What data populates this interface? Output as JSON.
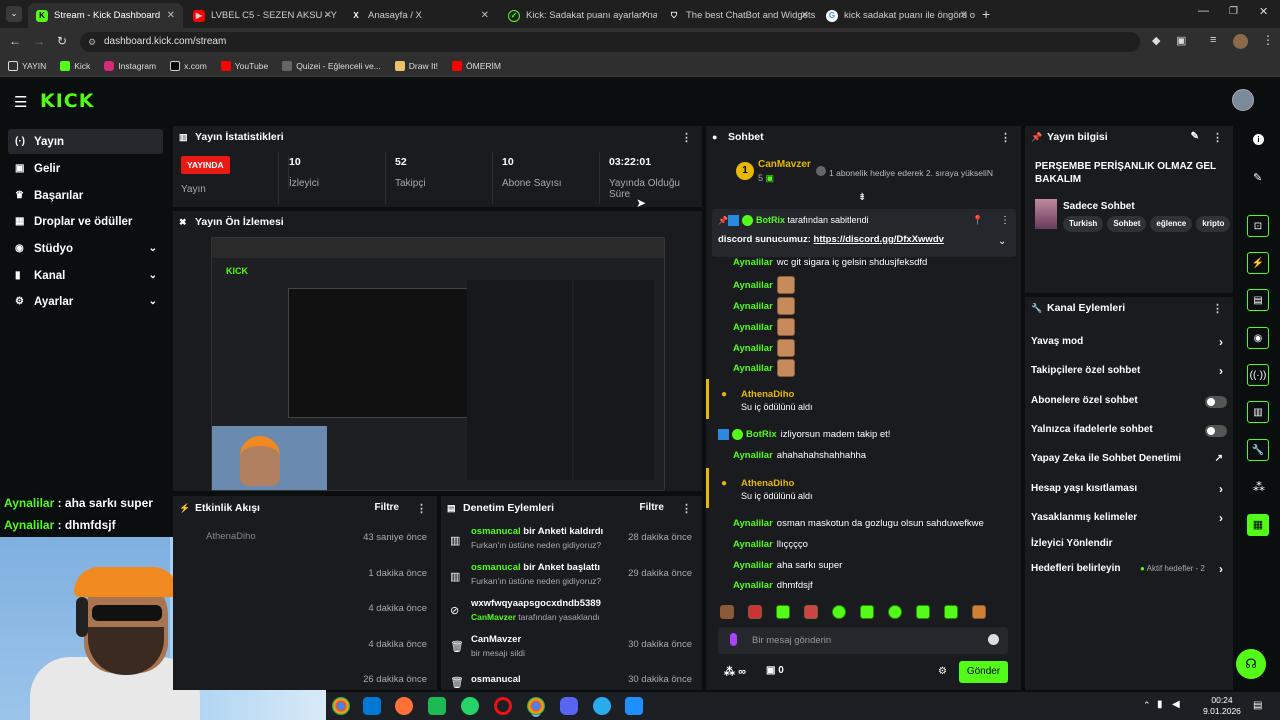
{
  "browser": {
    "tabs": [
      {
        "title": "Stream - Kick Dashboard",
        "color": "#53fc18",
        "active": true
      },
      {
        "title": "LVBEL C5 - SEZEN AKSU - Y",
        "color": "#ff0000"
      },
      {
        "title": "Anasayfa / X",
        "color": "#000000"
      },
      {
        "title": "Kick: Sadakat puanı ayarları nas",
        "color": "#53fc18"
      },
      {
        "title": "The best ChatBot and Widgets",
        "color": "#6a5acd"
      },
      {
        "title": "kick sadakat puanı ile öngörü o",
        "color": "#4285f4"
      }
    ],
    "url": "dashboard.kick.com/stream",
    "bookmarks": [
      "YAYIN",
      "Kick",
      "Instagram",
      "x.com",
      "YouTube",
      "Quizei - Eğlenceli ve...",
      "Draw It!",
      "ÖMERİM"
    ]
  },
  "sidebar": {
    "items": [
      {
        "label": "Yayın",
        "icon": "(·)"
      },
      {
        "label": "Gelir",
        "icon": "▣"
      },
      {
        "label": "Başarılar",
        "icon": "🏆"
      },
      {
        "label": "Droplar ve ödüller",
        "icon": "▣"
      },
      {
        "label": "Stüdyo",
        "icon": "◉"
      },
      {
        "label": "Kanal",
        "icon": "▮"
      },
      {
        "label": "Ayarlar",
        "icon": "⚙"
      }
    ]
  },
  "stats": {
    "title": "Yayın İstatistikleri",
    "live_badge": "YAYINDA",
    "live_label": "Yayın",
    "viewers": "10",
    "viewers_label": "İzleyici",
    "followers": "52",
    "followers_label": "Takipçi",
    "subs": "10",
    "subs_label": "Abone Sayısı",
    "duration": "03:22:01",
    "duration_label": "Yayında Olduğu Süre"
  },
  "preview": {
    "title": "Yayın Ön İzlemesi"
  },
  "overlay_chat": [
    {
      "user": "Aynalilar",
      "text": "aha sarkı super"
    },
    {
      "user": "Aynalilar",
      "text": "dhmfdsjf"
    }
  ],
  "activity": {
    "title": "Etkinlik Akışı",
    "filter": "Filtre",
    "rows": [
      "43 saniye önce",
      "1 dakika önce",
      "4 dakika önce",
      "4 dakika önce",
      "26 dakika önce"
    ],
    "first_user": "AthenaDiho"
  },
  "moderation": {
    "title": "Denetim Eylemleri",
    "filter": "Filtre",
    "rows": [
      {
        "who": "osmanucal",
        "what": "bir Anketi kaldırdı",
        "sub": "Furkan'ın üstüne neden gidiyoruz?",
        "time": "28 dakika önce"
      },
      {
        "who": "osmanucal",
        "what": "bir Anket başlattı",
        "sub": "Furkan'ın üstüne neden gidiyoruz?",
        "time": "29 dakika önce"
      },
      {
        "who": "wxwfwqyaapsgocxdndb5389",
        "what": "",
        "sub2_user": "CanMavzer",
        "sub": "tarafından yasaklandı",
        "time": "30 dakika önce"
      },
      {
        "who": "CanMavzer",
        "what": "",
        "sub": "bir mesajı sildi",
        "time": "30 dakika önce"
      },
      {
        "who": "osmanucal",
        "what": "",
        "sub": "",
        "time": "30 dakika önce"
      }
    ]
  },
  "chat": {
    "title": "Sohbet",
    "leader": {
      "name": "CanMavzer",
      "rank": "1",
      "count": "5",
      "note": "1 abonelik hediye ederek 2. sıraya yükseliN"
    },
    "pinned_by_user": "BotRix",
    "pinned_by_text": "tarafından sabitlendi",
    "pinned_msg": "discord sunucumuz:",
    "pinned_link": "https://discord.gg/DfxXwwdv",
    "messages": [
      {
        "user": "Aynalilar",
        "text": "wc git sigara iç gelsin shdusjfeksdfd"
      },
      {
        "user": "Aynalilar",
        "text": ""
      },
      {
        "user": "Aynalilar",
        "text": ""
      },
      {
        "user": "Aynalilar",
        "text": ""
      },
      {
        "user": "Aynalilar",
        "text": ""
      },
      {
        "user": "Aynalilar",
        "text": ""
      }
    ],
    "reward1_user": "AthenaDiho",
    "reward1_text": "Su iç ödülünü aldı",
    "botrix_user": "BotRix",
    "botrix_text": "izliyorsun madem takip et!",
    "msg_after_bot": {
      "user": "Aynalilar",
      "text": "ahahahahshahhahha"
    },
    "reward2_user": "AthenaDiho",
    "reward2_text": "Su iç ödülünü aldı",
    "tail": [
      {
        "user": "Aynalilar",
        "text": "osman maskotun da gozlugu olsun sahduwefkwe"
      },
      {
        "user": "Aynalilar",
        "text": "llıçççço"
      },
      {
        "user": "Aynalilar",
        "text": "aha sarkı super"
      },
      {
        "user": "Aynalilar",
        "text": "dhmfdsjf"
      }
    ],
    "input_placeholder": "Bir mesaj gönderin",
    "points": "∞",
    "gift_count": "0",
    "send": "Gönder"
  },
  "stream_info": {
    "title": "Yayın bilgisi",
    "stream_title": "PERŞEMBE PERİŞANLIK OLMAZ GEL BAKALIM",
    "category": "Sadece Sohbet",
    "tags": [
      "Turkish",
      "Sohbet",
      "eğlence",
      "kripto"
    ]
  },
  "channel_actions": {
    "title": "Kanal Eylemleri",
    "rows": [
      {
        "label": "Yavaş mod",
        "kind": "arrow"
      },
      {
        "label": "Takipçilere özel sohbet",
        "kind": "arrow"
      },
      {
        "label": "Abonelere özel sohbet",
        "kind": "toggle"
      },
      {
        "label": "Yalnızca ifadelerle sohbet",
        "kind": "toggle"
      },
      {
        "label": "Yapay Zeka ile Sohbet Denetimi",
        "kind": "ext"
      },
      {
        "label": "Hesap yaşı kısıtlaması",
        "kind": "arrow"
      },
      {
        "label": "Yasaklanmış kelimeler",
        "kind": "arrow"
      },
      {
        "label": "İzleyici Yönlendir",
        "kind": "none"
      },
      {
        "label": "Hedefleri belirleyin",
        "kind": "goal"
      }
    ],
    "goal_text": "Aktif hedefler - 2"
  },
  "taskbar": {
    "time": "00:24",
    "date": "9.01.2026"
  },
  "colors": {
    "accent": "#53fc18",
    "live": "#e91916",
    "panel": "#191b1f",
    "bg": "#0b0e0f"
  }
}
